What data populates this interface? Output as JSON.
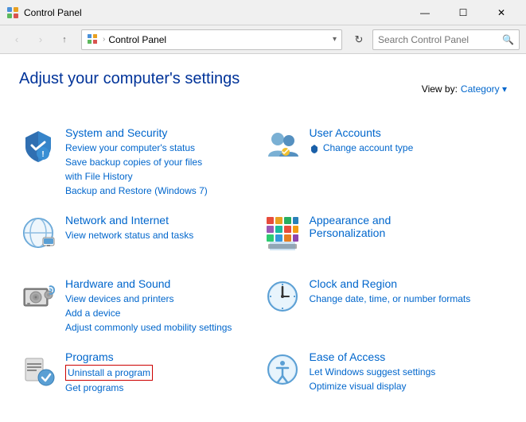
{
  "titleBar": {
    "icon": "control-panel-icon",
    "title": "Control Panel",
    "minimize": "—",
    "maximize": "☐",
    "close": "✕"
  },
  "navBar": {
    "back": "‹",
    "forward": "›",
    "up": "↑",
    "addressLabel": "Control Panel",
    "searchPlaceholder": "Search Control Panel",
    "refresh": "↻"
  },
  "header": {
    "title": "Adjust your computer's settings",
    "viewBy": "View by:",
    "viewByValue": "Category"
  },
  "categories": [
    {
      "id": "system-security",
      "title": "System and Security",
      "subs": [
        "Review your computer's status",
        "Save backup copies of your files with File History",
        "Backup and Restore (Windows 7)"
      ],
      "subHighlighted": []
    },
    {
      "id": "user-accounts",
      "title": "User Accounts",
      "subs": [
        "Change account type"
      ],
      "subHighlighted": []
    },
    {
      "id": "network-internet",
      "title": "Network and Internet",
      "subs": [
        "View network status and tasks"
      ],
      "subHighlighted": []
    },
    {
      "id": "appearance",
      "title": "Appearance and Personalization",
      "subs": [],
      "subHighlighted": []
    },
    {
      "id": "hardware-sound",
      "title": "Hardware and Sound",
      "subs": [
        "View devices and printers",
        "Add a device",
        "Adjust commonly used mobility settings"
      ],
      "subHighlighted": []
    },
    {
      "id": "clock-region",
      "title": "Clock and Region",
      "subs": [
        "Change date, time, or number formats"
      ],
      "subHighlighted": []
    },
    {
      "id": "programs",
      "title": "Programs",
      "subs": [
        "Uninstall a program",
        "Get programs"
      ],
      "highlighted": [
        "Uninstall a program"
      ]
    },
    {
      "id": "ease-of-access",
      "title": "Ease of Access",
      "subs": [
        "Let Windows suggest settings",
        "Optimize visual display"
      ],
      "subHighlighted": []
    }
  ]
}
